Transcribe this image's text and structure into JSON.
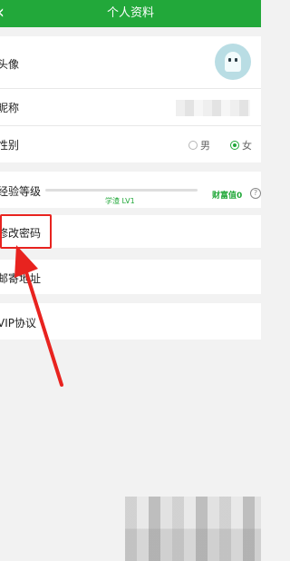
{
  "header": {
    "back_icon": "chevron-left-icon",
    "title": "个人资料"
  },
  "profile": {
    "avatar_label": "头像",
    "nickname_label": "昵称",
    "gender_label": "性别",
    "gender_options": [
      "男",
      "女"
    ],
    "gender_selected": "女"
  },
  "experience": {
    "label": "经验等级",
    "level_text": "学渣 LV1",
    "progress": 0,
    "wealth_label": "财富值0",
    "help_symbol": "?"
  },
  "menu": {
    "change_password": "修改密码",
    "mailing_address": "邮寄地址",
    "vip_agreement": "VIP协议"
  },
  "colors": {
    "brand": "#22a83a",
    "annotation": "#e8231f"
  }
}
